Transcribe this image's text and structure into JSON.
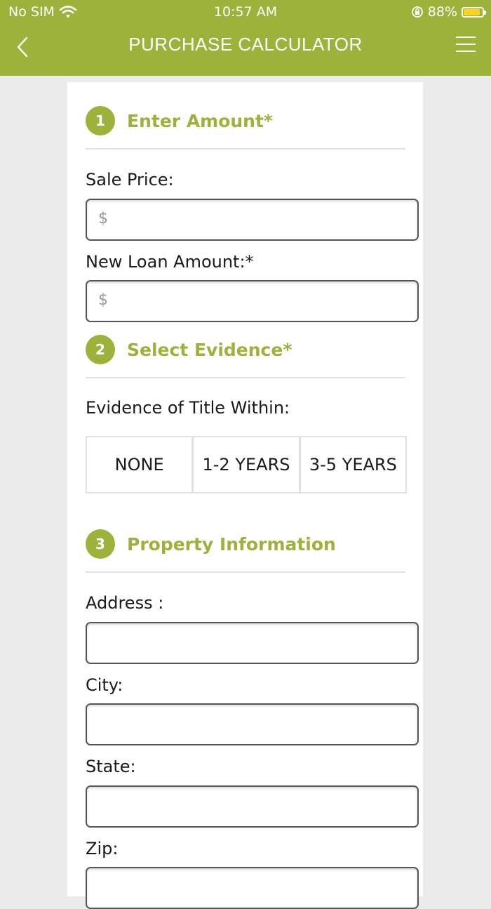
{
  "status_bar": {
    "carrier": "No SIM",
    "time": "10:57 AM",
    "battery": "88%",
    "battery_level": 0.88
  },
  "header": {
    "title": "PURCHASE CALCULATOR",
    "back_icon": "chevron-left-icon",
    "menu_icon": "hamburger-menu-icon"
  },
  "colors": {
    "accent": "#9cb23a",
    "background": "#ebebeb",
    "battery": "#ffd21f"
  },
  "sections": [
    {
      "number": "1",
      "title": "Enter Amount*",
      "fields": [
        {
          "label": "Sale Price:",
          "prefix": "$",
          "value": ""
        },
        {
          "label": "New Loan Amount:*",
          "prefix": "$",
          "value": ""
        }
      ]
    },
    {
      "number": "2",
      "title": "Select Evidence*",
      "label": "Evidence of Title Within:",
      "options": [
        "NONE",
        "1-2 YEARS",
        "3-5 YEARS"
      ]
    },
    {
      "number": "3",
      "title": "Property Information",
      "fields": [
        {
          "label": "Address :",
          "value": ""
        },
        {
          "label": "City:",
          "value": ""
        },
        {
          "label": "State:",
          "value": ""
        },
        {
          "label": "Zip:",
          "value": ""
        }
      ]
    }
  ]
}
